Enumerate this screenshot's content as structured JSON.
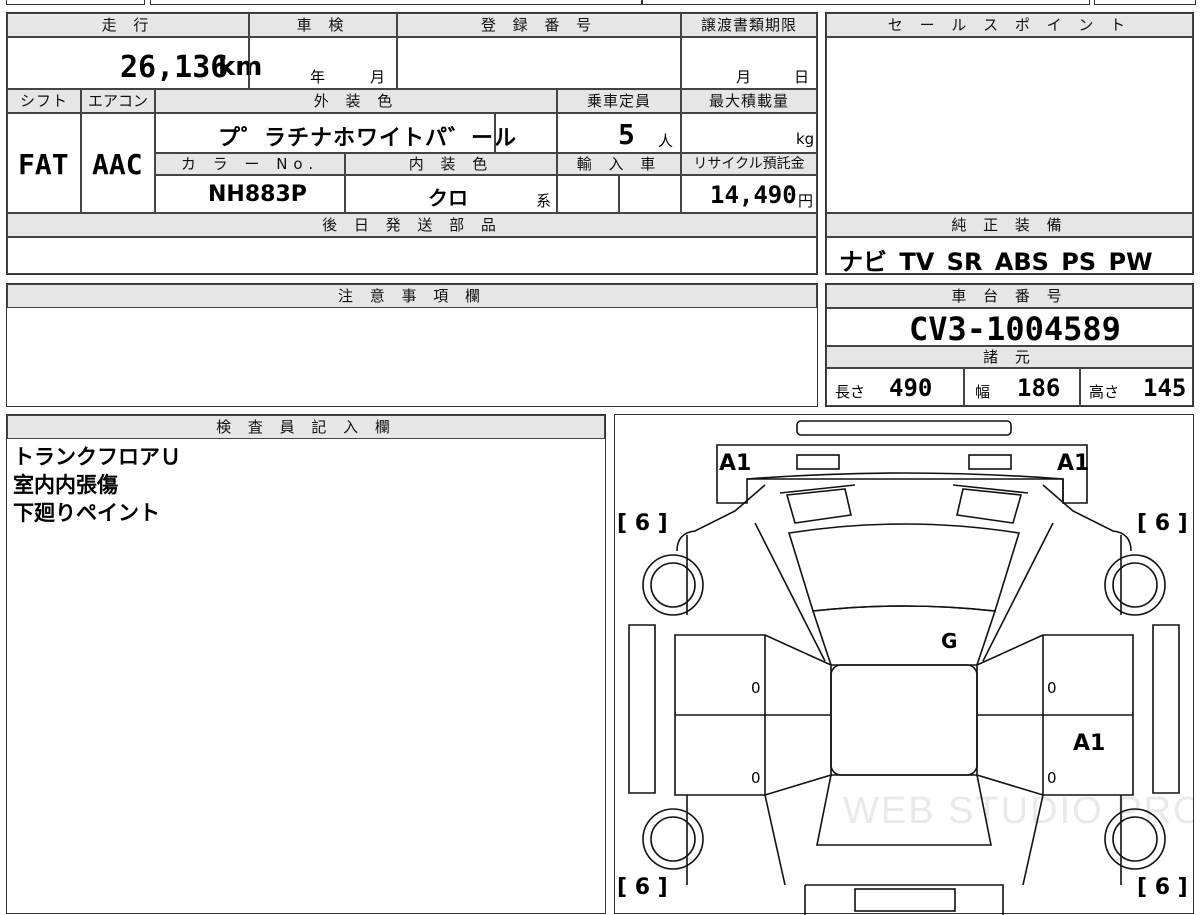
{
  "summary": {
    "mileage_label": "走 行",
    "mileage_value": "26,136",
    "mileage_unit": "km",
    "inspection_label": "車 検",
    "inspection_year": "年",
    "inspection_month": "月",
    "registration_label": "登 録 番 号",
    "transfer_label": "譲渡書類期限",
    "transfer_month": "月",
    "transfer_day": "日"
  },
  "spec": {
    "shift_label": "シフト",
    "shift_value": "FAT",
    "ac_label": "エアコン",
    "ac_value": "AAC",
    "exterior_label": "外 装 色",
    "exterior_value": "プ゜ラチナホワイトパ゛ール",
    "capacity_label": "乗車定員",
    "capacity_value": "5",
    "capacity_unit": "人",
    "maxload_label": "最大積載量",
    "maxload_unit": "kg",
    "color_no_label": "カ ラ ー No.",
    "color_no_value": "NH883P",
    "interior_label": "内 装 色",
    "interior_value": "クロ",
    "interior_suffix": "系",
    "import_label": "輸 入 車",
    "recycle_label": "リサイクル預託金",
    "recycle_value": "14,490",
    "recycle_unit": "円",
    "later_parts_label": "後 日 発 送 部 品"
  },
  "sales_point": {
    "label": "セ ー ル ス ポ イ ン ト"
  },
  "equipment": {
    "label": "純 正 装 備",
    "value": "ナビ TV SR ABS PS PW"
  },
  "notes": {
    "label": "注 意 事 項 欄"
  },
  "chassis": {
    "label": "車 台 番 号",
    "value": "CV3-1004589",
    "dims_label": "諸 元",
    "length_label": "長さ",
    "length_value": "490",
    "width_label": "幅",
    "width_value": "186",
    "height_label": "高さ",
    "height_value": "145"
  },
  "inspector": {
    "label": "検 査 員 記 入 欄",
    "lines": [
      "トランクフロアＵ",
      "室内内張傷",
      "下廻りペイント"
    ]
  },
  "diagram": {
    "marks": [
      "A1",
      "A1",
      "G",
      "A1"
    ],
    "tires": [
      "[ 6 ]",
      "[ 6 ]",
      "[ 6 ]",
      "[ 6 ]"
    ],
    "zeros": [
      "0",
      "0",
      "0",
      "0"
    ],
    "watermark": "WEB STUDIO PRO"
  }
}
